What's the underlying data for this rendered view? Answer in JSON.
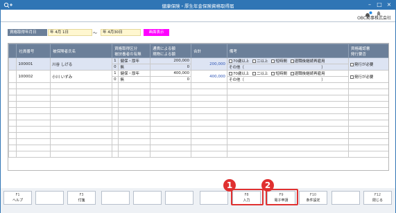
{
  "window": {
    "title": "健康保険・厚生年金保険資格取得届"
  },
  "header": {
    "company": "OBC商事株式会社"
  },
  "filter": {
    "label": "資格取得年月日",
    "from": "年  4月  1日",
    "tilde": "～",
    "to": "年  4月30日",
    "display_button": "画面表示"
  },
  "table": {
    "headers": {
      "emp_no": "社員番号",
      "name": "被保険者氏名",
      "qual_a": "資格取得区分",
      "qual_b": "被扶養者の有無",
      "pay_a": "通貨による額",
      "pay_b": "現物による額",
      "total": "合計",
      "remarks": "備考",
      "confirm_a": "資格確認書",
      "confirm_b": "発行要否"
    },
    "rows": [
      {
        "emp_no": "100001",
        "name": "川谷  しげる",
        "code1": "1",
        "kbn1": "健保・厚年",
        "cash": "200,000",
        "code2": "0",
        "kbn2": "無",
        "kind": "0",
        "total": "200,000",
        "r1": "70歳以上",
        "r2": "二以上",
        "r3": "短時間",
        "r4": "退職後継続再雇用",
        "other": "その他（",
        "other_close": "）",
        "confirm": "発行が必要"
      },
      {
        "emp_no": "100002",
        "name": "小川  いずみ",
        "code1": "1",
        "kbn1": "健保・厚年",
        "cash": "400,000",
        "code2": "0",
        "kbn2": "無",
        "kind": "0",
        "total": "400,000",
        "r1": "70歳以上",
        "r2": "二以上",
        "r3": "短時間",
        "r4": "退職後継続再雇用",
        "other": "その他（",
        "other_close": "）",
        "confirm": "発行が必要"
      }
    ]
  },
  "fkeys": {
    "f1": {
      "key": "F1",
      "label": "ヘルプ"
    },
    "f3": {
      "key": "F3",
      "label": "付箋"
    },
    "f8": {
      "key": "F8",
      "label": "入力"
    },
    "f9": {
      "key": "F9",
      "label": "電子申請"
    },
    "f10": {
      "key": "F10",
      "label": "条件設定"
    },
    "f12": {
      "key": "F12",
      "label": "閉じる"
    }
  },
  "callouts": {
    "c1": "1",
    "c2": "2"
  },
  "colors": {
    "accent": "#2f75b5",
    "header_bg": "#6b7f99",
    "highlight": "#e03030",
    "display_btn": "#ff00ff"
  }
}
